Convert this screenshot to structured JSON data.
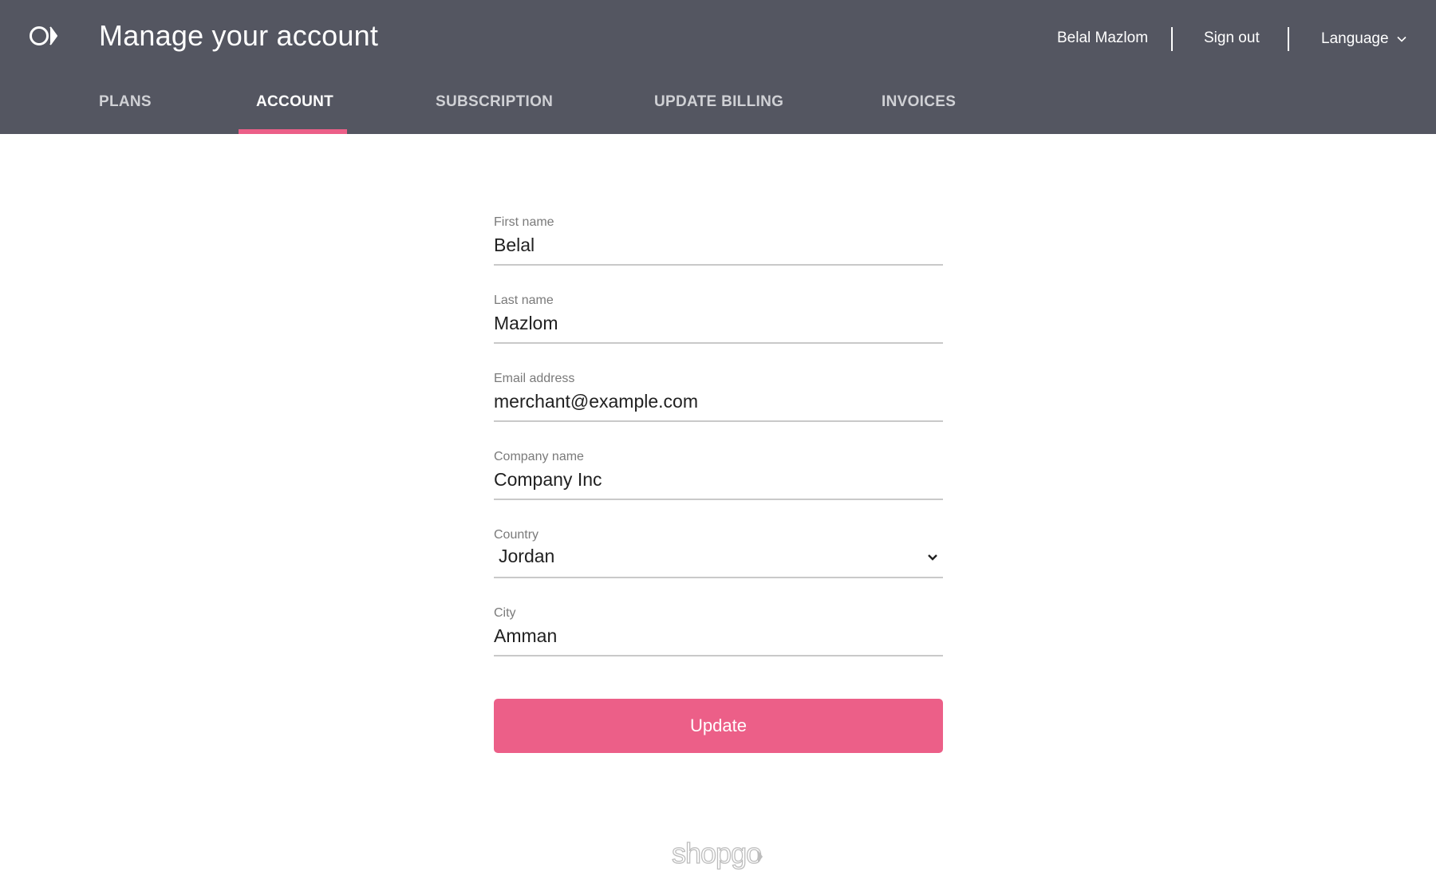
{
  "header": {
    "title": "Manage your account",
    "user_name": "Belal Mazlom",
    "sign_out": "Sign out",
    "language": "Language",
    "background_color": "#545661",
    "accent_color": "#ec5f88"
  },
  "tabs": [
    {
      "label": "PLANS",
      "active": false
    },
    {
      "label": "ACCOUNT",
      "active": true
    },
    {
      "label": "SUBSCRIPTION",
      "active": false
    },
    {
      "label": "UPDATE BILLING",
      "active": false
    },
    {
      "label": "INVOICES",
      "active": false
    }
  ],
  "form": {
    "first_name": {
      "label": "First name",
      "value": "Belal"
    },
    "last_name": {
      "label": "Last name",
      "value": "Mazlom"
    },
    "email": {
      "label": "Email address",
      "value": "merchant@example.com"
    },
    "company": {
      "label": "Company name",
      "value": "Company Inc"
    },
    "country": {
      "label": "Country",
      "value": "Jordan"
    },
    "city": {
      "label": "City",
      "value": "Amman"
    },
    "submit_label": "Update"
  },
  "footer": {
    "brand": "shopgo"
  },
  "icons": {
    "logo": "shopgo-logo-icon",
    "language_chevron": "chevron-down-icon",
    "country_chevron": "chevron-down-icon"
  }
}
